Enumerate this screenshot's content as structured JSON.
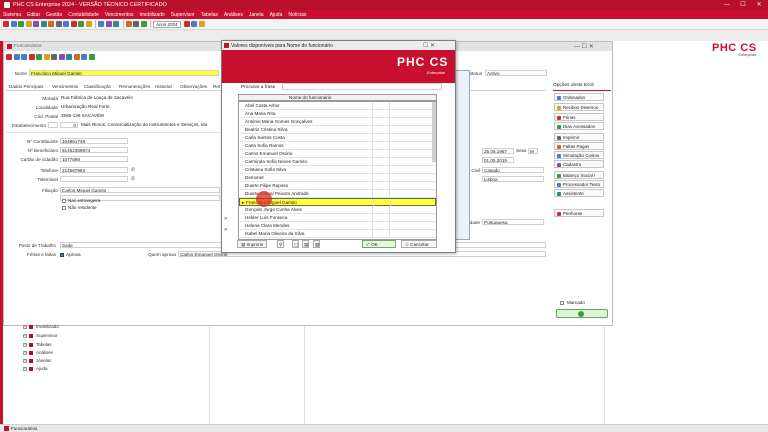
{
  "window": {
    "title": "PHC CS Enterprise 2024 - VERSÃO TÉCNICO CERTIFICADO",
    "minimize": "—",
    "maximize": "☐",
    "close": "✕"
  },
  "menu": [
    "Sistema",
    "Editar",
    "Gestão",
    "Contabilidade",
    "Vencimentos",
    "Imobilizado",
    "Supervisor",
    "Tabelas",
    "Análises",
    "Janela",
    "Ajuda",
    "Notícias"
  ],
  "toolbar": {
    "year_label": "Anos 2024"
  },
  "brand": {
    "name": "PHC CS",
    "sub": "Enterprise"
  },
  "form": {
    "title": "Funcionários",
    "nome_label": "Nome",
    "nome_value": "Francisco Miguel Gamito",
    "status_label": "Status",
    "status_value": "Activo",
    "options_label": "Opções deste Ecrã",
    "tabs": [
      "Dados Principais",
      "Vencimentos",
      "Classificação",
      "Remunerações",
      "Historial",
      "Observações",
      "Ret"
    ],
    "morada_label": "Morada",
    "morada_value": "Rua Fábrica de Louça de Sacavém",
    "localidade_label": "Localidade",
    "localidade_value": "Urbanização Real Forte",
    "codpostal_label": "Cód. Postal",
    "codpostal_value": "2685-136 SACAVÉM",
    "estab_label": "Estabelecimento",
    "estab_code": "0",
    "estab_value": "Mais Rimos, Comercialização de Instrumentos e Serviços, lda",
    "contrib_label": "Nº Contribuinte",
    "contrib_value": "164861748",
    "benef_label": "Nº Beneficiário",
    "benef_value": "91452369874",
    "cartao_label": "Cartão de cidadão",
    "cartao_value": "1077899",
    "telefone_label": "Telefone",
    "telefone_value": "214567963",
    "telemovel_label": "Telemóvel",
    "telemovel_value": "",
    "filiacao_label": "Filiação",
    "filiacao_value": "Carlos Miguel Gamito",
    "nac_label": "Nac.estrangeira",
    "nres_label": "Não residente",
    "nasc_date": "25.06.1967",
    "adm_date": "01.05.2019",
    "sexo_label": "Sexo",
    "sexo_value": "M",
    "civil_label": "do Civil",
    "civil_value": "Casado",
    "concelho_value": "Lisboa",
    "nacional_label": "nalidade",
    "nacional_value": "Portuguesa",
    "posto_label": "Posto de Trabalho",
    "posto_value": "Sede",
    "ferias_label": "Férias e faltas",
    "aprova_label": "Aprova",
    "quem_label": "Quem aprova",
    "quem_value": "Carlos Emanuel Osório",
    "marcado_label": "Marcado"
  },
  "side_buttons": [
    {
      "label": "Ordenados",
      "color": "#4a7cc7"
    },
    {
      "label": "Recibos Diversos",
      "color": "#d9a520"
    },
    {
      "label": "Férias",
      "color": "#c8302e"
    },
    {
      "label": "Dias Acessados",
      "color": "#3b9a3b"
    },
    {
      "label": "Imprimir",
      "color": "#666666"
    },
    {
      "label": "Faltas Pagas",
      "color": "#d06a20"
    },
    {
      "label": "Simulação Custos",
      "color": "#4a7cc7"
    },
    {
      "label": "Cadastro",
      "color": "#8a4ab0"
    },
    {
      "label": "Balanço Social / RU",
      "color": "#3b9a3b"
    },
    {
      "label": "Processador Texto",
      "color": "#4a7cc7"
    },
    {
      "label": "Assistente",
      "color": "#2a8a8a"
    },
    {
      "label": "Penhoras",
      "color": "#c8302e"
    }
  ],
  "tree": [
    "Imobilizado",
    "Supervisor",
    "Tabelas",
    "Análises",
    "Janelas",
    "Ajuda"
  ],
  "status_bar": {
    "item": "Funcionários"
  },
  "modal": {
    "title": "Valores disponíveis para Nome do funcionário",
    "search_label": "Procurar a frase",
    "search_placeholder": "",
    "column_header": "Nome do funcionário",
    "names": [
      "Abel Costa Arbur",
      "Ana Maria Rita",
      "António Maria Gomes Gonçalves",
      "Beatriz Cristina Silva",
      "Carla Santos Costa",
      "Carla Sofia Ramos",
      "Carlos Emanuel Osório",
      "Carminda Sofia Neves Gamito",
      "Cristiana Sofia Silva",
      "Demonet",
      "Duarte Filipe Raposo",
      "Duarte Cabral Peixoto Andrade",
      "Francisco Miguel Gamito",
      "Gonçalo Jorge Cunha Alves",
      "Helder Luís Fonseca",
      "Helena Clara Mendes",
      "Isabel Maria Oliveira da Silva"
    ],
    "selected_index": 12,
    "print_label": "Imprimir",
    "ok_label": "OK",
    "cancel_label": "Cancelar"
  }
}
